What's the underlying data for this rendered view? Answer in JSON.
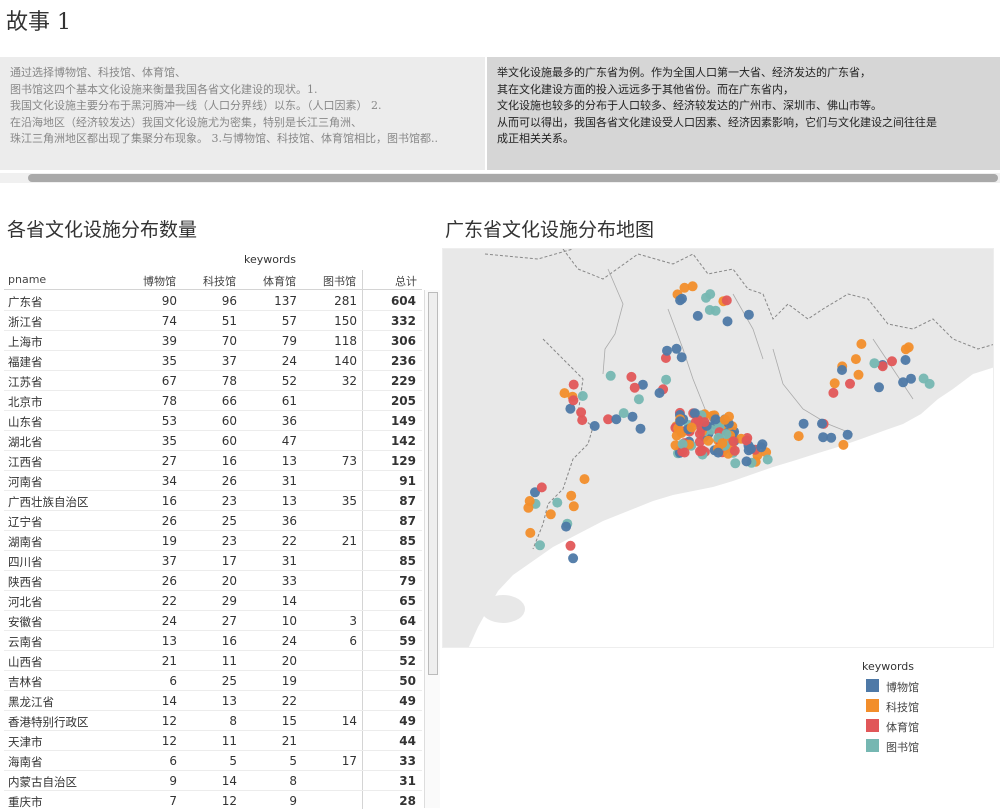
{
  "story": {
    "title": "故事 1",
    "caption_left": "通过选择博物馆、科技馆、体育馆、\n图书馆这四个基本文化设施来衡量我国各省文化建设的现状。1.\n我国文化设施主要分布于黑河腾冲一线（人口分界线）以东。（人口因素） 2.\n在沿海地区（经济较发达）我国文化设施尤为密集，特别是长江三角洲、\n珠江三角洲地区都出现了集聚分布现象。 3.与博物馆、科技馆、体育馆相比，图书馆都..",
    "caption_right": "举文化设施最多的广东省为例。作为全国人口第一大省、经济发达的广东省，\n其在文化建设方面的投入远远多于其他省份。而在广东省内，\n文化设施也较多的分布于人口较多、经济较发达的广州市、深圳市、佛山市等。\n从而可以得出，我国各省文化建设受人口因素、经济因素影响，它们与文化建设之间往往是\n成正相关关系。"
  },
  "table_sheet": {
    "title": "各省文化设施分布数量",
    "keywords_header": "keywords",
    "columns": [
      "pname",
      "博物馆",
      "科技馆",
      "体育馆",
      "图书馆",
      "总计"
    ],
    "rows": [
      [
        "广东省",
        "90",
        "96",
        "137",
        "281",
        "604"
      ],
      [
        "浙江省",
        "74",
        "51",
        "57",
        "150",
        "332"
      ],
      [
        "上海市",
        "39",
        "70",
        "79",
        "118",
        "306"
      ],
      [
        "福建省",
        "35",
        "37",
        "24",
        "140",
        "236"
      ],
      [
        "江苏省",
        "67",
        "78",
        "52",
        "32",
        "229"
      ],
      [
        "北京市",
        "78",
        "66",
        "61",
        "",
        "205"
      ],
      [
        "山东省",
        "53",
        "60",
        "36",
        "",
        "149"
      ],
      [
        "湖北省",
        "35",
        "60",
        "47",
        "",
        "142"
      ],
      [
        "江西省",
        "27",
        "16",
        "13",
        "73",
        "129"
      ],
      [
        "河南省",
        "34",
        "26",
        "31",
        "",
        "91"
      ],
      [
        "广西壮族自治区",
        "16",
        "23",
        "13",
        "35",
        "87"
      ],
      [
        "辽宁省",
        "26",
        "25",
        "36",
        "",
        "87"
      ],
      [
        "湖南省",
        "19",
        "23",
        "22",
        "21",
        "85"
      ],
      [
        "四川省",
        "37",
        "17",
        "31",
        "",
        "85"
      ],
      [
        "陕西省",
        "26",
        "20",
        "33",
        "",
        "79"
      ],
      [
        "河北省",
        "22",
        "29",
        "14",
        "",
        "65"
      ],
      [
        "安徽省",
        "24",
        "27",
        "10",
        "3",
        "64"
      ],
      [
        "云南省",
        "13",
        "16",
        "24",
        "6",
        "59"
      ],
      [
        "山西省",
        "21",
        "11",
        "20",
        "",
        "52"
      ],
      [
        "吉林省",
        "6",
        "25",
        "19",
        "",
        "50"
      ],
      [
        "黑龙江省",
        "14",
        "13",
        "22",
        "",
        "49"
      ],
      [
        "香港特别行政区",
        "12",
        "8",
        "15",
        "14",
        "49"
      ],
      [
        "天津市",
        "12",
        "11",
        "21",
        "",
        "44"
      ],
      [
        "海南省",
        "6",
        "5",
        "5",
        "17",
        "33"
      ],
      [
        "内蒙古自治区",
        "9",
        "14",
        "8",
        "",
        "31"
      ],
      [
        "重庆市",
        "7",
        "12",
        "9",
        "",
        "28"
      ]
    ]
  },
  "map_sheet": {
    "title": "广东省文化设施分布地图",
    "legend_title": "keywords",
    "legend": [
      {
        "label": "博物馆",
        "color": "#4e79a7"
      },
      {
        "label": "科技馆",
        "color": "#f28e2b"
      },
      {
        "label": "体育馆",
        "color": "#e15759"
      },
      {
        "label": "图书馆",
        "color": "#76b7b2"
      }
    ]
  }
}
